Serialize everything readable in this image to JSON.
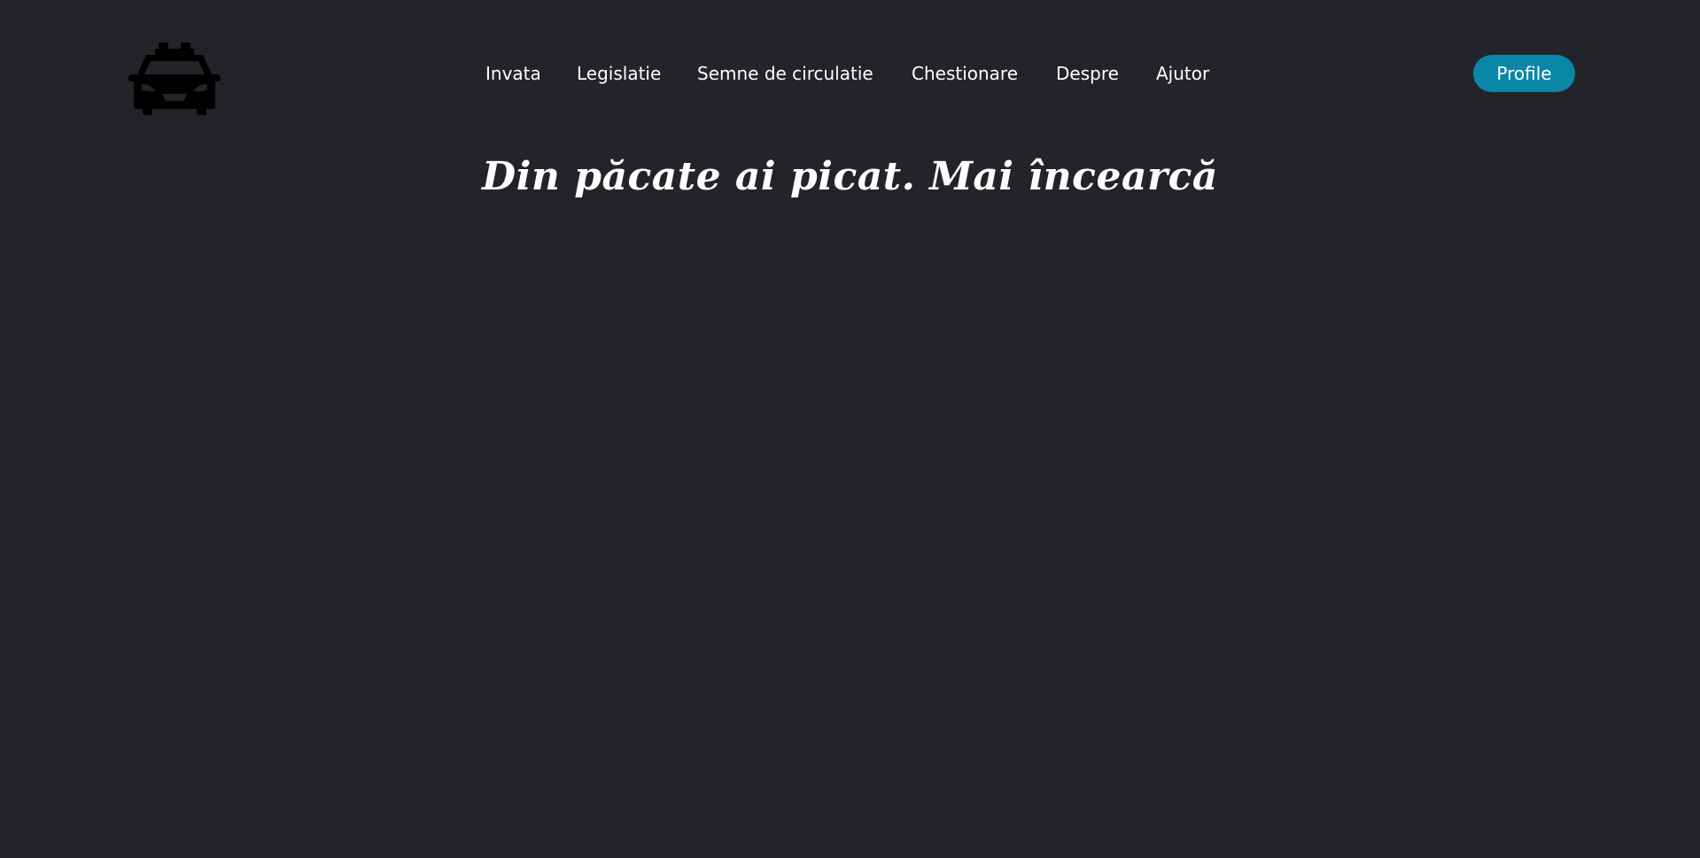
{
  "header": {
    "logo_icon": "taxi-car-icon",
    "nav": [
      {
        "label": "Invata"
      },
      {
        "label": "Legislatie"
      },
      {
        "label": "Semne de circulatie"
      },
      {
        "label": "Chestionare"
      },
      {
        "label": "Despre"
      },
      {
        "label": "Ajutor"
      }
    ],
    "profile_label": "Profile"
  },
  "main": {
    "result_message": "Din păcate ai picat. Mai încearcă"
  },
  "colors": {
    "background": "#232429",
    "accent": "#0a86a8",
    "text": "#ffffff",
    "logo": "#000000"
  }
}
